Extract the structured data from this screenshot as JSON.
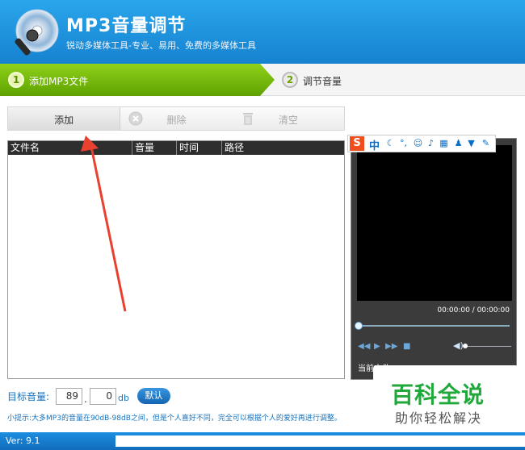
{
  "header": {
    "title": "MP3音量调节",
    "subtitle": "锐动多媒体工具-专业、易用、免费的多媒体工具"
  },
  "steps": [
    {
      "num": "1",
      "label": "添加MP3文件",
      "active": true
    },
    {
      "num": "2",
      "label": "调节音量",
      "active": false
    }
  ],
  "toolbar": {
    "add_label": "添加",
    "delete_label": "删除",
    "clear_label": "清空"
  },
  "file_table": {
    "columns": [
      "文件名",
      "音量",
      "时间",
      "路径"
    ],
    "rows": []
  },
  "player": {
    "time": "00:00:00 / 00:00:00",
    "current_file_label": "当前文件:"
  },
  "ime": {
    "logo": "S",
    "mode": "中"
  },
  "target_volume": {
    "label": "目标音量:",
    "int_value": "89",
    "dec_value": "0",
    "separator": ".",
    "unit": "db",
    "default_button": "默认"
  },
  "tip": "小提示:大多MP3的音量在90dB-98dB之间，但是个人喜好不同，完全可以根据个人的爱好再进行调整。",
  "status": {
    "version": "Ver: 9.1"
  },
  "watermark": {
    "main": "百科全说",
    "sub": "助你轻松解决"
  },
  "colors": {
    "header": "#1a8ad9",
    "step_active": "#6db300",
    "accent_text": "#1673c0",
    "watermark": "#20a83a"
  }
}
